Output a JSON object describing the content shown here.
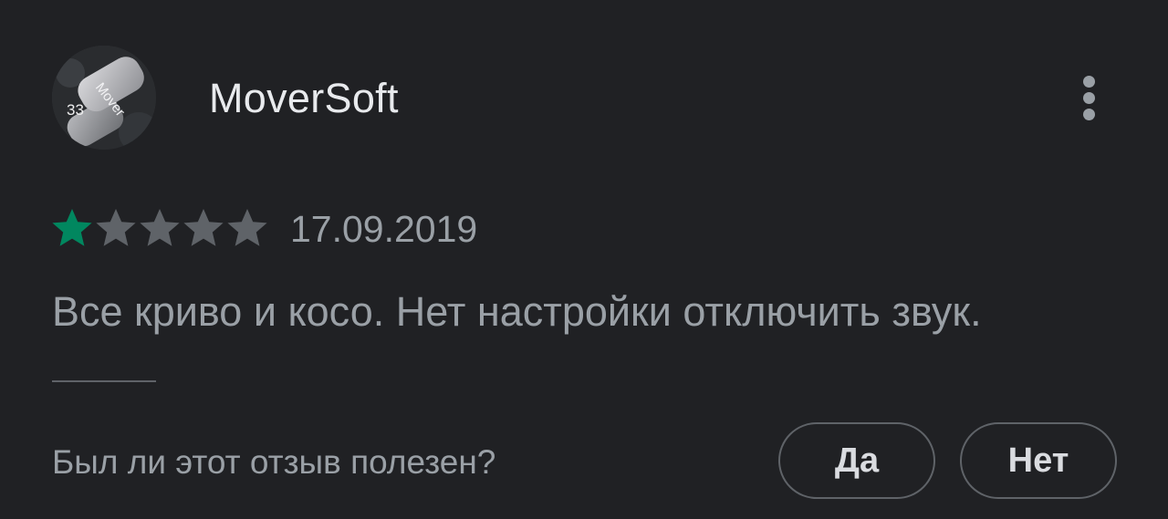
{
  "review": {
    "author_name": "MoverSoft",
    "avatar_text": "Mover",
    "avatar_number": "33",
    "rating": 1,
    "rating_max": 5,
    "date": "17.09.2019",
    "text": "Все криво и косо. Нет настройки отключить звук.",
    "helpful_question": "Был ли этот отзыв полезен?",
    "yes_label": "Да",
    "no_label": "Нет"
  },
  "colors": {
    "background": "#202124",
    "star_filled": "#01875f",
    "star_empty": "#5f6368",
    "text_primary": "#e8eaed",
    "text_secondary": "#9aa0a6",
    "button_border": "#5f6368"
  },
  "icons": {
    "more": "more-vert-icon",
    "star": "star-icon"
  }
}
